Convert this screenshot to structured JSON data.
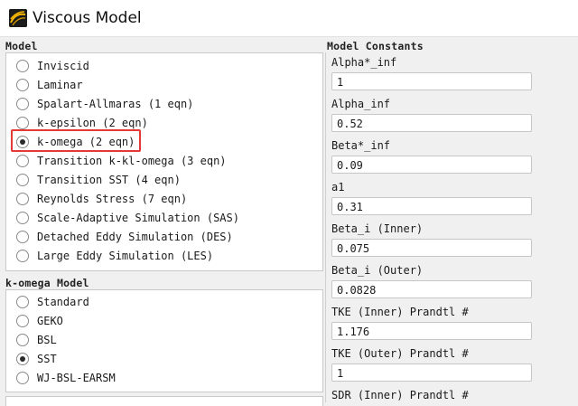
{
  "window": {
    "title": "Viscous Model"
  },
  "model": {
    "label": "Model",
    "options": [
      {
        "label": "Inviscid",
        "checked": false
      },
      {
        "label": "Laminar",
        "checked": false
      },
      {
        "label": "Spalart-Allmaras (1 eqn)",
        "checked": false
      },
      {
        "label": "k-epsilon (2 eqn)",
        "checked": false
      },
      {
        "label": "k-omega (2 eqn)",
        "checked": true
      },
      {
        "label": "Transition k-kl-omega (3 eqn)",
        "checked": false
      },
      {
        "label": "Transition SST (4 eqn)",
        "checked": false
      },
      {
        "label": "Reynolds Stress (7 eqn)",
        "checked": false
      },
      {
        "label": "Scale-Adaptive Simulation (SAS)",
        "checked": false
      },
      {
        "label": "Detached Eddy Simulation (DES)",
        "checked": false
      },
      {
        "label": "Large Eddy Simulation (LES)",
        "checked": false
      }
    ]
  },
  "komega": {
    "label": "k-omega Model",
    "options": [
      {
        "label": "Standard",
        "checked": false
      },
      {
        "label": "GEKO",
        "checked": false
      },
      {
        "label": "BSL",
        "checked": false
      },
      {
        "label": "SST",
        "checked": true
      },
      {
        "label": "WJ-BSL-EARSM",
        "checked": false
      }
    ]
  },
  "constants": {
    "label": "Model Constants",
    "items": [
      {
        "label": "Alpha*_inf",
        "value": "1"
      },
      {
        "label": "Alpha_inf",
        "value": "0.52"
      },
      {
        "label": "Beta*_inf",
        "value": "0.09"
      },
      {
        "label": "a1",
        "value": "0.31"
      },
      {
        "label": "Beta_i (Inner)",
        "value": "0.075"
      },
      {
        "label": "Beta_i (Outer)",
        "value": "0.0828"
      },
      {
        "label": "TKE (Inner) Prandtl #",
        "value": "1.176"
      },
      {
        "label": "TKE (Outer) Prandtl #",
        "value": "1"
      },
      {
        "label": "SDR (Inner) Prandtl #",
        "value": ""
      }
    ]
  },
  "colors": {
    "highlight": "#e53935",
    "panel": "#ffffff",
    "background": "#f0f0f0"
  }
}
